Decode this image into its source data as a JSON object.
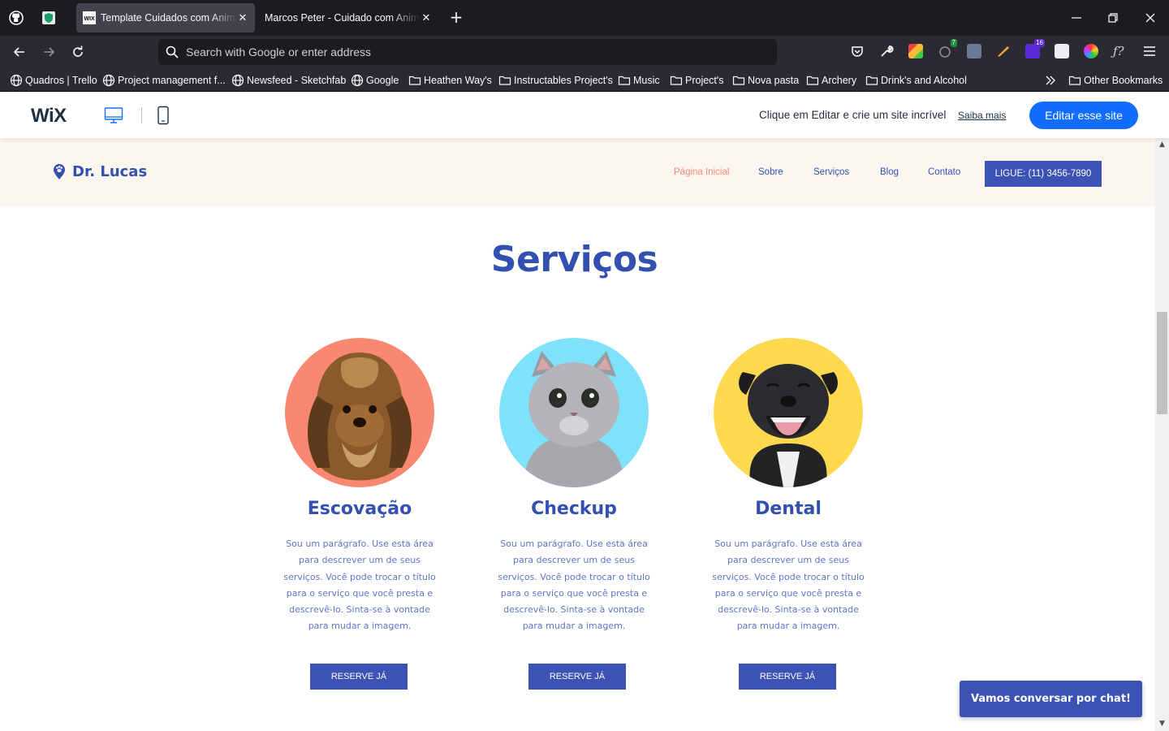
{
  "browser": {
    "tabs": [
      {
        "title": "Template Cuidados com Animais",
        "active": true,
        "favicon": "wix-favicon"
      },
      {
        "title": "Marcos Peter - Cuidado com Animais",
        "active": false,
        "favicon": "none"
      }
    ],
    "address_placeholder": "Search with Google or enter address",
    "extension_badges": {
      "ext3": "7",
      "ext6": "16"
    },
    "bookmarks": [
      {
        "label": "Quadros | Trello",
        "icon": "globe-icon"
      },
      {
        "label": "Project management f...",
        "icon": "globe-icon"
      },
      {
        "label": "Newsfeed - Sketchfab",
        "icon": "globe-icon"
      },
      {
        "label": "Google",
        "icon": "globe-icon"
      },
      {
        "label": "Heathen Way's",
        "icon": "folder-icon"
      },
      {
        "label": "Instructables Project's",
        "icon": "folder-icon"
      },
      {
        "label": "Music",
        "icon": "folder-icon"
      },
      {
        "label": "Project's",
        "icon": "folder-icon"
      },
      {
        "label": "Nova pasta",
        "icon": "folder-icon"
      },
      {
        "label": "Archery",
        "icon": "folder-icon"
      },
      {
        "label": "Drink's and Alcohol",
        "icon": "folder-icon"
      }
    ],
    "other_bookmarks": "Other Bookmarks"
  },
  "wix_bar": {
    "logo": "WiX",
    "promo_text": "Clique em Editar e crie um site incrível",
    "learn_more": "Saiba mais",
    "edit_button": "Editar esse site",
    "accent": "#116dff"
  },
  "site": {
    "brand": "Dr. Lucas",
    "menu": [
      "Página Inicial",
      "Sobre",
      "Serviços",
      "Blog",
      "Contato"
    ],
    "active_menu_index": 0,
    "call_button": "LIGUE: (11) 3456-7890",
    "section_title": "Serviços",
    "services": [
      {
        "title": "Escovação",
        "bg_color": "#f98872",
        "animal": "dog-yorkie",
        "text": "Sou um parágrafo. Use esta área para descrever um de seus serviços. Você pode trocar o título para o serviço que você presta e descrevê-lo. Sinta-se à vontade para mudar a imagem.",
        "button": "RESERVE JÁ"
      },
      {
        "title": "Checkup",
        "bg_color": "#7ee2fb",
        "animal": "cat-grey",
        "text": "Sou um parágrafo. Use esta área para descrever um de seus serviços. Você pode trocar o título para o serviço que você presta e descrevê-lo. Sinta-se à vontade para mudar a imagem.",
        "button": "RESERVE JÁ"
      },
      {
        "title": "Dental",
        "bg_color": "#fdd94f",
        "animal": "dog-pitbull",
        "text": "Sou um parágrafo. Use esta área para descrever um de seus serviços. Você pode trocar o título para o serviço que você presta e descrevê-lo. Sinta-se à vontade para mudar a imagem.",
        "button": "RESERVE JÁ"
      }
    ],
    "chat_button": "Vamos conversar por chat!",
    "colors": {
      "primary": "#3350b0",
      "button": "#3c52b5",
      "header_bg": "#fbf7f0",
      "active_link": "#f78a78"
    }
  }
}
